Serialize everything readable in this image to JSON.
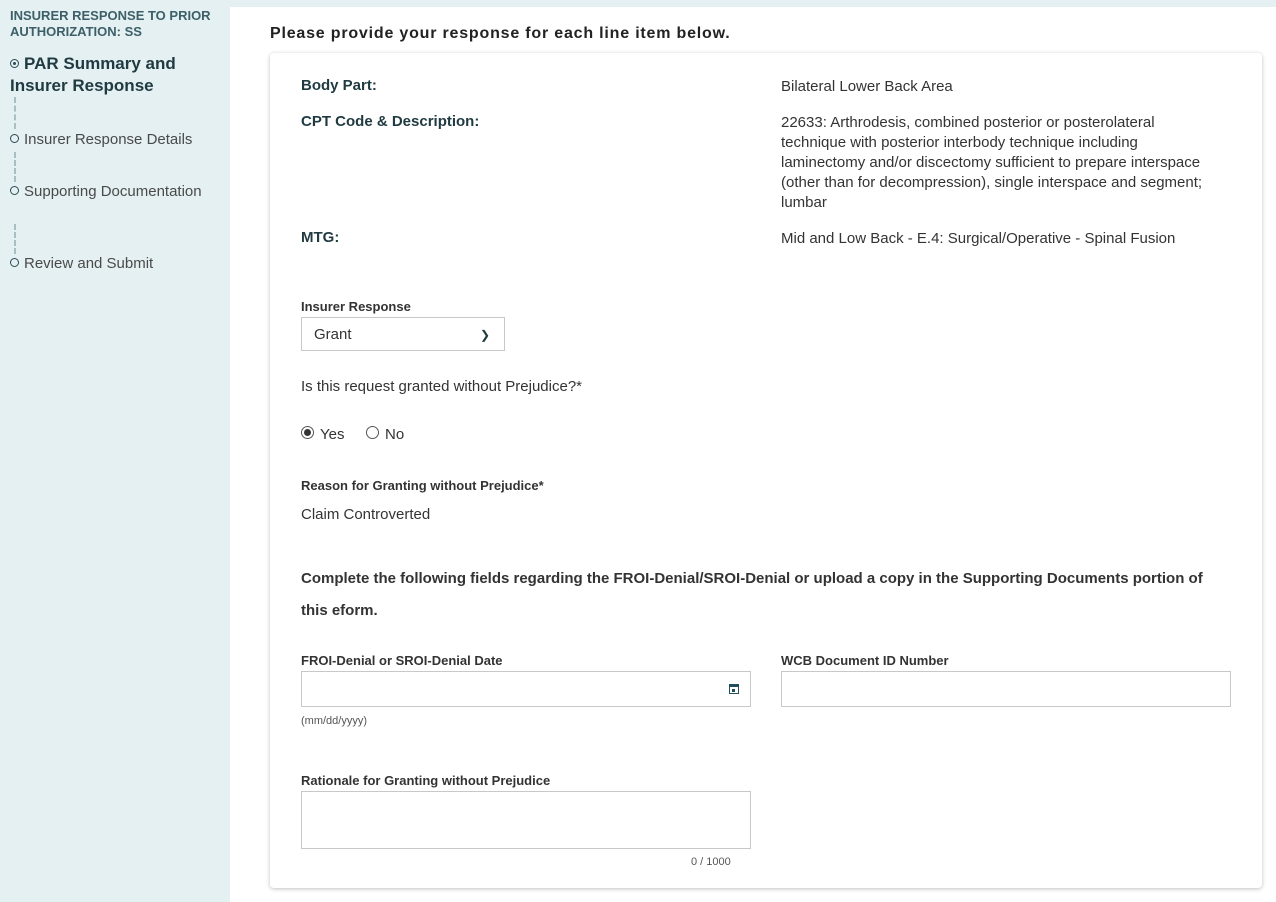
{
  "sidebar": {
    "title": "INSURER RESPONSE TO PRIOR AUTHORIZATION: SS",
    "steps": [
      {
        "label": "PAR Summary and Insurer Response",
        "active": true
      },
      {
        "label": "Insurer Response Details"
      },
      {
        "label": "Supporting Documentation"
      },
      {
        "label": "Review and Submit"
      }
    ]
  },
  "main": {
    "heading": "Please provide your response for each line item below.",
    "details": [
      {
        "label": "Body Part:",
        "value": "Bilateral Lower Back Area"
      },
      {
        "label": "CPT Code & Description:",
        "value": "22633: Arthrodesis, combined posterior or posterolateral technique with posterior interbody technique including laminectomy and/or discectomy sufficient to prepare interspace (other than for decompression), single interspace and segment; lumbar"
      },
      {
        "label": "MTG:",
        "value": "Mid and Low Back - E.4: Surgical/Operative - Spinal Fusion"
      }
    ],
    "insurer_response": {
      "label": "Insurer Response",
      "value": "Grant"
    },
    "question": "Is this request granted without Prejudice?*",
    "radio": {
      "yes": "Yes",
      "no": "No",
      "selected": "Yes"
    },
    "reason": {
      "label": "Reason for Granting without Prejudice*",
      "value": "Claim Controverted"
    },
    "instruction": "Complete the following fields regarding the FROI-Denial/SROI-Denial or upload a copy in the Supporting Documents portion of this eform.",
    "date_field": {
      "label": "FROI-Denial or SROI-Denial Date",
      "value": "",
      "hint": "(mm/dd/yyyy)"
    },
    "wcb_field": {
      "label": "WCB Document ID Number",
      "value": ""
    },
    "rationale": {
      "label": "Rationale for Granting without Prejudice",
      "value": "",
      "counter": "0 / 1000"
    }
  }
}
